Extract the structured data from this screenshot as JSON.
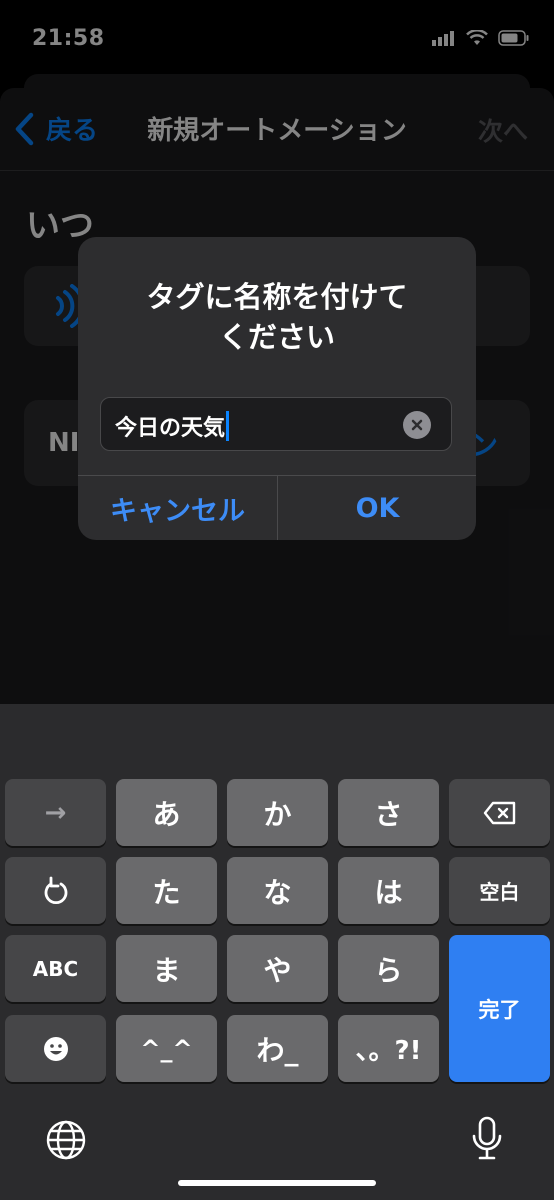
{
  "status_bar": {
    "time": "21:58"
  },
  "nav": {
    "back_label": "戻る",
    "title": "新規オートメーション",
    "next_label": "次へ"
  },
  "section": {
    "title": "いつ"
  },
  "card2": {
    "text": "NI",
    "right_text": "ン"
  },
  "alert": {
    "title_line1": "タグに名称を付けて",
    "title_line2": "ください",
    "input_value": "今日の天気",
    "cancel_label": "キャンセル",
    "ok_label": "OK"
  },
  "keyboard": {
    "row1": [
      "→",
      "あ",
      "か",
      "さ"
    ],
    "row2": [
      "た",
      "な",
      "は"
    ],
    "space_label": "空白",
    "row3_left": "ABC",
    "row3": [
      "ま",
      "や",
      "ら"
    ],
    "done_label": "完了",
    "row4": [
      "^_^",
      "わ_",
      "、。?!"
    ]
  },
  "colors": {
    "accent": "#0a84ff",
    "done_key": "#2f7ff2",
    "alert_bg": "#2d2d2f"
  }
}
